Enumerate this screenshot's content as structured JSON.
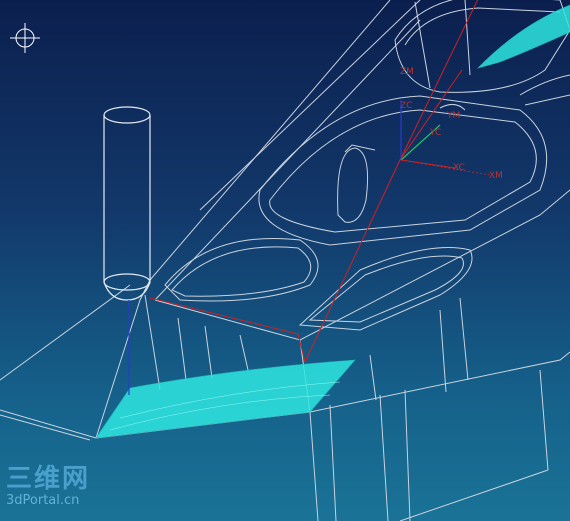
{
  "viewport": {
    "background_top": "#0b1f4e",
    "background_bottom": "#1a7397",
    "wireframe_color": "#c9d3de",
    "toolpath_color": "#2ee6e0",
    "engage_line_color": "#d02020",
    "axis_color": "#2a3ad0"
  },
  "icons": {
    "cursor": "crosshair-icon",
    "tool": "end-mill-tool"
  },
  "axes": {
    "zm": "ZM",
    "zc": "ZC",
    "ym": "YM",
    "yc": "YC",
    "xc": "XC",
    "xm": "XM"
  },
  "watermark": {
    "chinese": "三维网",
    "url": "3dPortal.cn"
  }
}
